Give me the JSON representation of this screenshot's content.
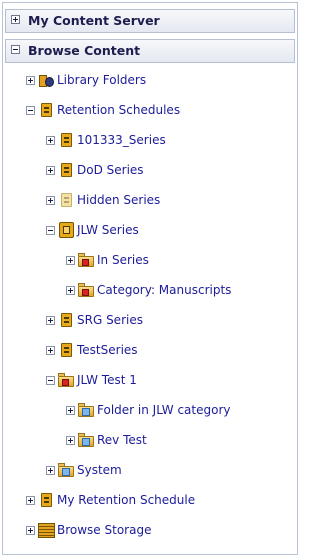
{
  "sections": {
    "my_content_server": "My Content Server",
    "browse_content": "Browse Content"
  },
  "tree": [
    {
      "label": "Library Folders",
      "icon": "library-folders-icon",
      "expander": "plus"
    },
    {
      "label": "Retention Schedules",
      "icon": "retention-schedule-icon",
      "expander": "minus"
    },
    {
      "label": "101333_Series",
      "icon": "retention-schedule-icon",
      "expander": "plus"
    },
    {
      "label": "DoD Series",
      "icon": "retention-schedule-icon",
      "expander": "plus"
    },
    {
      "label": "Hidden Series",
      "icon": "hidden-series-icon",
      "expander": "plus"
    },
    {
      "label": "JLW Series",
      "icon": "series-icon",
      "expander": "minus"
    },
    {
      "label": "In Series",
      "icon": "category-folder-icon",
      "expander": "plus"
    },
    {
      "label": "Category: Manuscripts",
      "icon": "category-folder-icon",
      "expander": "plus"
    },
    {
      "label": "SRG Series",
      "icon": "retention-schedule-icon",
      "expander": "plus"
    },
    {
      "label": "TestSeries",
      "icon": "retention-schedule-icon",
      "expander": "plus"
    },
    {
      "label": "JLW Test 1",
      "icon": "category-folder-icon",
      "expander": "minus"
    },
    {
      "label": "Folder in JLW category",
      "icon": "record-folder-icon",
      "expander": "plus"
    },
    {
      "label": "Rev Test",
      "icon": "record-folder-icon",
      "expander": "plus"
    },
    {
      "label": "System",
      "icon": "system-folder-icon",
      "expander": "plus"
    },
    {
      "label": "My Retention Schedule",
      "icon": "retention-schedule-icon",
      "expander": "plus"
    },
    {
      "label": "Browse Storage",
      "icon": "storage-icon",
      "expander": "plus"
    }
  ],
  "colors": {
    "link_text": "#1c1c9a",
    "header_text": "#1d1d4f",
    "schedule_icon": "#e7a81a",
    "category_marker": "#d92222",
    "folder_marker": "#7fb6ea"
  }
}
